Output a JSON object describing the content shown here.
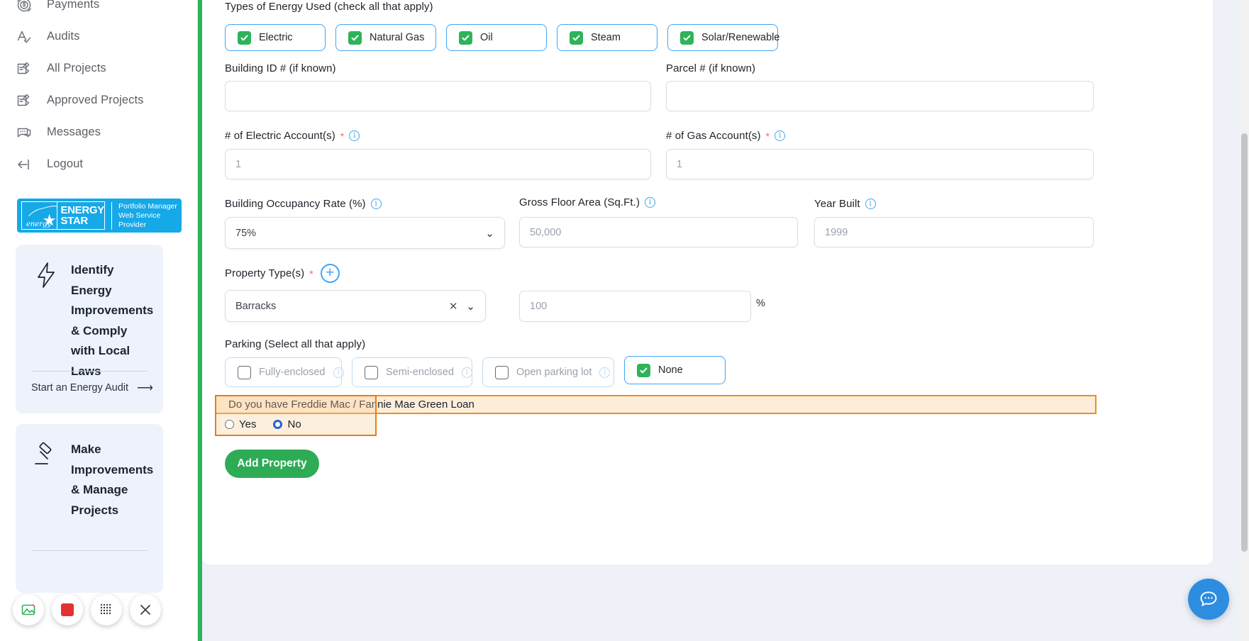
{
  "sidebar": {
    "items": [
      {
        "label": "Payments",
        "icon": "payments-icon"
      },
      {
        "label": "Audits",
        "icon": "audits-icon"
      },
      {
        "label": "All Projects",
        "icon": "all-projects-icon"
      },
      {
        "label": "Approved Projects",
        "icon": "approved-projects-icon"
      },
      {
        "label": "Messages",
        "icon": "messages-icon"
      },
      {
        "label": "Logout",
        "icon": "logout-icon"
      }
    ],
    "logo": {
      "brand_line1": "ENERGY",
      "brand_line2": "STAR",
      "script": "energy",
      "partner_line1": "Portfolio Manager",
      "partner_line2": "Web Service Provider",
      "color": "#15a9e8"
    },
    "promos": [
      {
        "title": "Identify Energy Improvements & Comply with Local Laws",
        "icon": "lightning-bolt-icon",
        "cta": "Start an Energy Audit"
      },
      {
        "title": "Make Improvements & Manage Projects",
        "icon": "gavel-icon",
        "cta": ""
      }
    ],
    "recorder": {
      "buttons": [
        "screenshot-icon",
        "stop-record-icon",
        "grid-icon",
        "close-icon"
      ]
    }
  },
  "form": {
    "energy_types": {
      "label": "Types of Energy Used (check all that apply)",
      "options": [
        {
          "label": "Electric",
          "checked": true
        },
        {
          "label": "Natural Gas",
          "checked": true
        },
        {
          "label": "Oil",
          "checked": true
        },
        {
          "label": "Steam",
          "checked": true
        },
        {
          "label": "Solar/Renewable",
          "checked": true
        }
      ]
    },
    "building_id": {
      "label": "Building ID # (if known)",
      "value": "",
      "placeholder": ""
    },
    "parcel": {
      "label": "Parcel # (if known)",
      "value": "",
      "placeholder": ""
    },
    "electric_accounts": {
      "label": "# of Electric Account(s)",
      "required": true,
      "value": "1",
      "placeholder": "1"
    },
    "gas_accounts": {
      "label": "# of Gas Account(s)",
      "required": true,
      "value": "1",
      "placeholder": "1"
    },
    "occupancy": {
      "label": "Building Occupancy Rate (%)",
      "value": "75%"
    },
    "gross_floor_area": {
      "label": "Gross Floor Area (Sq.Ft.)",
      "value": "50,000",
      "placeholder": "50,000"
    },
    "year_built": {
      "label": "Year Built",
      "value": "1999",
      "placeholder": "1999"
    },
    "property_types": {
      "label": "Property Type(s)",
      "required": true,
      "add_button": "+",
      "selected": "Barracks",
      "percent": "100",
      "percent_suffix": "%"
    },
    "parking": {
      "label": "Parking (Select all that apply)",
      "options": [
        {
          "label": "Fully-enclosed",
          "checked": false,
          "dimmed": true
        },
        {
          "label": "Semi-enclosed",
          "checked": false,
          "dimmed": true
        },
        {
          "label": "Open parking lot",
          "checked": false,
          "dimmed": true
        },
        {
          "label": "None",
          "checked": true,
          "dimmed": false
        }
      ]
    },
    "green_loan": {
      "question": "Do you have Freddie Mac / Fannie Mae Green Loan",
      "options": [
        {
          "label": "Yes",
          "selected": false
        },
        {
          "label": "No",
          "selected": true
        }
      ]
    },
    "submit": "Add Property"
  },
  "colors": {
    "green": "#2eb35a",
    "blue": "#42a5f5",
    "highlight_border": "#e87c16",
    "highlight_fill": "#fdeedb"
  }
}
